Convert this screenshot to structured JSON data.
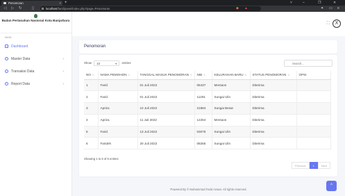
{
  "browser": {
    "tab_title": "Penomoran",
    "tab_close": "×",
    "new_tab": "+",
    "url_host": "localhost",
    "url_path": "/farid/panel/index.php?page=Penomoran",
    "window_controls": [
      "˅",
      "–",
      "❐",
      "✕"
    ]
  },
  "sidebar": {
    "brand": "Badan Pertanahan Nasional Kota Banjarbaru",
    "section_label": "MAIN",
    "items": [
      {
        "label": "Dashboard",
        "icon": "home-icon",
        "chevron": ""
      },
      {
        "label": "Master Data",
        "icon": "circle-icon",
        "chevron": "›"
      },
      {
        "label": "Transaksi Data",
        "icon": "circle-icon",
        "chevron": "›"
      },
      {
        "label": "Report Data",
        "icon": "circle-icon",
        "chevron": "›"
      }
    ]
  },
  "header": {
    "fullscreen_icon": "⛶",
    "avatar_glyph": "X"
  },
  "page": {
    "title": "Penomoran"
  },
  "table_controls": {
    "show_label": "Show",
    "entries_value": "10",
    "entries_label": "entries",
    "search_placeholder": "Search..."
  },
  "table": {
    "columns": [
      "NO",
      "NAMA PEMOHON",
      "TANGGAL MASUK PENOMORAN",
      "NIB",
      "KELURAHAN BARU",
      "STATUS PENOMORAN",
      "OPSI"
    ],
    "rows": [
      [
        "1",
        "Farid",
        "01 Juli 2022",
        "05437",
        "Mentaos",
        "Diterima",
        ""
      ],
      [
        "2",
        "Farid",
        "01 Juli 2022",
        "11291",
        "Sungai Ulin",
        "Diterima",
        ""
      ],
      [
        "3",
        "Apriza",
        "10 Juli 2022",
        "21884",
        "Sungai Besar",
        "Diterima",
        ""
      ],
      [
        "4",
        "Apriza",
        "11 Juli 2022",
        "12264",
        "Mentaos",
        "Diterima",
        ""
      ],
      [
        "5",
        "Farid",
        "13 Juli 2022",
        "03078",
        "Sungai Ulin",
        "Diterima",
        ""
      ],
      [
        "6",
        "Farideh",
        "20 Juli 2022",
        "08265",
        "Sungai Ulin",
        "Diterima",
        ""
      ]
    ],
    "info": "Showing 1 to 6 of 6 entries"
  },
  "pagination": {
    "previous": "Previous",
    "current": "1",
    "next": "Next"
  },
  "footer": {
    "text": "Powered By © Muhammad Farid Anwar. All rights reserved."
  },
  "scroll_top": "^",
  "colors": {
    "accent": "#6777ef",
    "background": "#f4f6f9"
  }
}
